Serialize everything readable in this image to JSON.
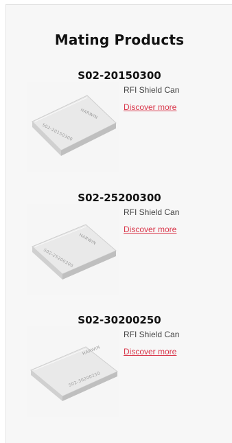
{
  "section": {
    "heading": "Mating Products"
  },
  "products": [
    {
      "sku": "S02-20150300",
      "description": "RFI Shield Can",
      "link_label": "Discover more",
      "image": {
        "brand_mark": "HARWIN",
        "part_mark": "S02-20150300"
      }
    },
    {
      "sku": "S02-25200300",
      "description": "RFI Shield Can",
      "link_label": "Discover more",
      "image": {
        "brand_mark": "HARWIN",
        "part_mark": "S02-25200300"
      }
    },
    {
      "sku": "S02-30200250",
      "description": "RFI Shield Can",
      "link_label": "Discover more",
      "image": {
        "brand_mark": "HARWIN",
        "part_mark": "S02-30200250"
      }
    }
  ],
  "colors": {
    "link": "#d9364a",
    "heading": "#111111",
    "panel_background": "#f7f7f7"
  }
}
